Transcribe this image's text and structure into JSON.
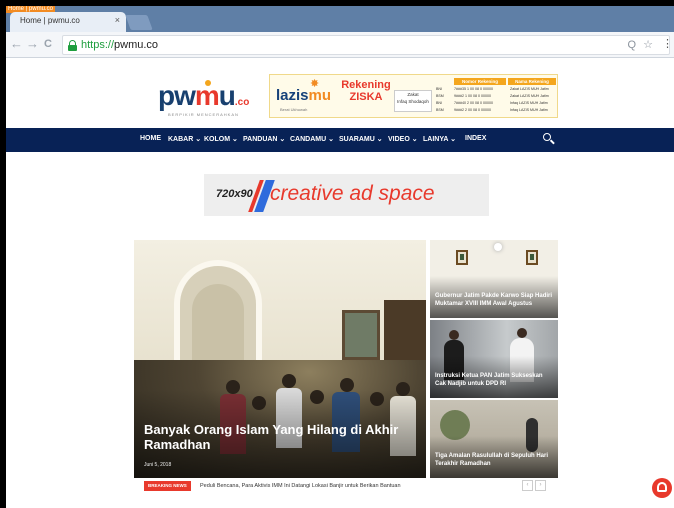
{
  "browser": {
    "tab_badge": "Home | pwmu.co",
    "tab_title": "Home | pwmu.co",
    "tab_close": "×",
    "url_scheme": "https://",
    "url_host": "pwmu.co",
    "back_icon": "←",
    "forward_icon": "→",
    "reload_icon": "C",
    "omnibox_icons": "Q ☆",
    "menu_icon": "⋮"
  },
  "site": {
    "logo": {
      "text_a": "pw",
      "text_o": "m",
      "text_b": "u",
      "suffix": ".co",
      "tagline": "BERPIKIR MENCERAHKAN"
    },
    "banner": {
      "brand_a": "lazis",
      "brand_b": "mu",
      "brand_sub": "Berat Ukhuwah",
      "heading": "Rekening ZISKA",
      "box": [
        "Zakat",
        "Infaq Shodaqoh"
      ],
      "col_headers": [
        "Nomor Rekening",
        "Nama Rekening"
      ],
      "rows": [
        {
          "bank": "BNI",
          "num": "7###35 1 00 08 0 00000",
          "name": "Zakat LAZIS MUH Jatim"
        },
        {
          "bank": "BSM",
          "num": "9###2 1 00 08 0 00000",
          "name": "Zakat LAZIS MUH Jatim"
        },
        {
          "bank": "BNI",
          "num": "7###40 2 00 08 0 00000",
          "name": "Infaq LAZIS MUH Jatim"
        },
        {
          "bank": "BSM",
          "num": "9###2 2 00 08 0 00000",
          "name": "Infaq LAZIS MUH Jatim"
        }
      ]
    },
    "nav": [
      {
        "label": "HOME"
      },
      {
        "label": "KABAR ⌄"
      },
      {
        "label": "KOLOM ⌄"
      },
      {
        "label": "PANDUAN ⌄"
      },
      {
        "label": "CANDAMU ⌄"
      },
      {
        "label": "SUARAMU ⌄"
      },
      {
        "label": "VIDEO ⌄"
      },
      {
        "label": "LAINYA ⌄"
      },
      {
        "label": "INDEX"
      }
    ],
    "ad": {
      "size": "720x90",
      "text": "creative ad space"
    },
    "featured": {
      "title": "Banyak Orang Islam Yang Hilang di Akhir Ramadhan",
      "date": "Juni 5, 2018"
    },
    "side_posts": [
      {
        "title": "Gubernur Jatim Pakde Karwo Siap Hadiri Muktamar XVIII IMM Awal Agustus"
      },
      {
        "title": "Instruksi Ketua PAN Jatim Sukseskan Cak Nadjib untuk DPD RI"
      },
      {
        "title": "Tiga Amalan Rasulullah di Sepuluh Hari Terakhir Ramadhan"
      }
    ],
    "breaking": {
      "label": "BREAKING NEWS",
      "text": "Peduli Bencana, Para Aktivis IMM Ini Datangi Lokasi Banjir untuk Berikan Bantuan",
      "prev": "‹",
      "next": "›"
    }
  }
}
